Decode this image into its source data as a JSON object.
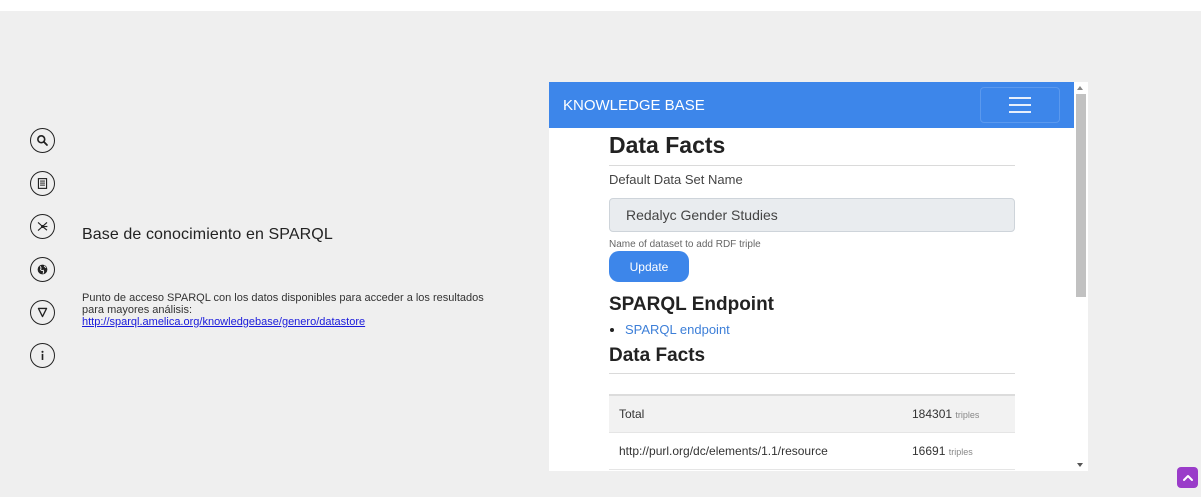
{
  "left_panel": {
    "icons": [
      "search-icon",
      "document-icon",
      "network-icon",
      "globe-icon",
      "play-icon",
      "info-icon"
    ],
    "title": "Base de conocimiento en SPARQL",
    "description": "Punto de acceso SPARQL con los datos disponibles para acceder a los resultados para mayores análisis:",
    "link": "http://sparql.amelica.org/knowledgebase/genero/datastore"
  },
  "frame": {
    "brand": "KNOWLEDGE BASE",
    "section_data_facts": "Data Facts",
    "default_label": "Default Data Set Name",
    "default_value": "Redalyc Gender Studies",
    "help_text": "Name of dataset to add RDF triple",
    "update_label": "Update",
    "section_sparql": "SPARQL Endpoint",
    "endpoint_link": "SPARQL endpoint",
    "section_facts": "Data Facts",
    "facts": [
      {
        "label": "Total",
        "value": "184301",
        "unit": "triples"
      },
      {
        "label": "http://purl.org/dc/elements/1.1/resource",
        "value": "16691",
        "unit": "triples"
      }
    ]
  },
  "colors": {
    "navbar": "#3d86ea",
    "back_to_top": "#9a3cc9",
    "link": "#1a1adb"
  }
}
